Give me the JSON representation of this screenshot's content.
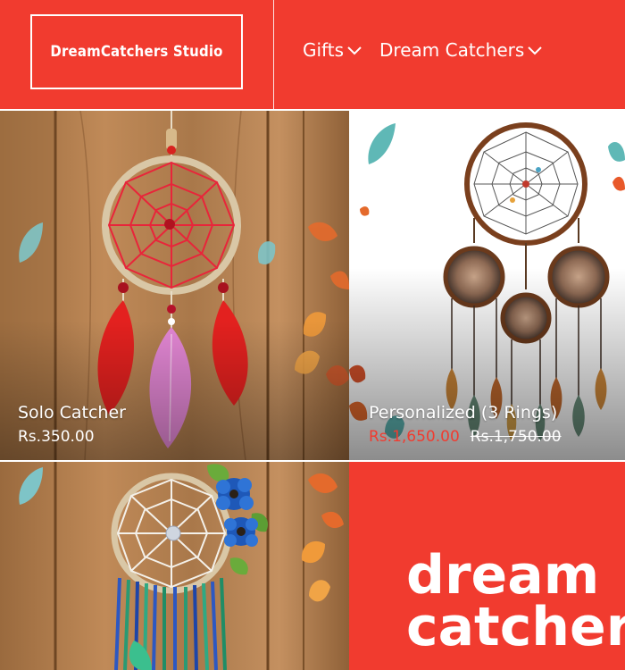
{
  "brand": {
    "name": "DreamCatchers Studio"
  },
  "nav": {
    "items": [
      {
        "label": "Gifts"
      },
      {
        "label": "Dream Catchers"
      }
    ]
  },
  "products": [
    {
      "name": "Solo Catcher",
      "price": "Rs.350.00"
    },
    {
      "name": "Personalized (3 Rings)",
      "sale_price": "Rs.1,650.00",
      "regular_price": "Rs.1,750.00"
    }
  ],
  "banner": {
    "line1": "dream",
    "line2": "catchers"
  },
  "colors": {
    "accent": "#f13b2f",
    "wood": "#b07b4c"
  },
  "icons": [
    "chevron-down-icon",
    "feather-icon",
    "dreamcatcher-illustration"
  ]
}
